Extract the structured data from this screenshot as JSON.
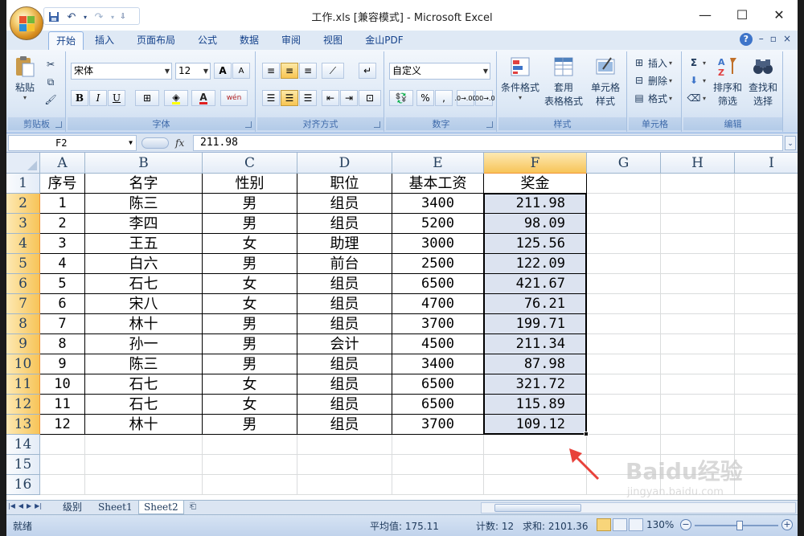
{
  "title_bar": {
    "title": "工作.xls  [兼容模式] - Microsoft Excel",
    "minimize": "—",
    "maximize": "☐",
    "close": "✕"
  },
  "tabs": [
    "开始",
    "插入",
    "页面布局",
    "公式",
    "数据",
    "审阅",
    "视图",
    "金山PDF"
  ],
  "ribbon": {
    "clipboard": {
      "label": "剪贴板",
      "paste": "粘贴"
    },
    "font": {
      "label": "字体",
      "name": "宋体",
      "size": "12",
      "bold": "B",
      "italic": "I",
      "underline": "U",
      "grow": "A",
      "shrink": "A",
      "font_color": "A",
      "phonetic": "wén"
    },
    "alignment": {
      "label": "对齐方式"
    },
    "number": {
      "label": "数字",
      "format": "自定义",
      "percent": "%"
    },
    "styles": {
      "label": "样式",
      "conditional": "条件格式",
      "table_line1": "套用",
      "table_line2": "表格格式",
      "cell_line1": "单元格",
      "cell_line2": "样式"
    },
    "cells": {
      "label": "单元格",
      "insert": "插入",
      "delete": "删除",
      "format": "格式"
    },
    "editing": {
      "label": "编辑",
      "sort_line1": "排序和",
      "sort_line2": "筛选",
      "find_line1": "查找和",
      "find_line2": "选择"
    }
  },
  "formula_bar": {
    "name_box": "F2",
    "fx": "fx",
    "formula": "211.98"
  },
  "columns": [
    "A",
    "B",
    "C",
    "D",
    "E",
    "F",
    "G",
    "H",
    "I"
  ],
  "rows": [
    "1",
    "2",
    "3",
    "4",
    "5",
    "6",
    "7",
    "8",
    "9",
    "10",
    "11",
    "12",
    "13",
    "14",
    "15",
    "16"
  ],
  "table": {
    "headers": [
      "序号",
      "名字",
      "性别",
      "职位",
      "基本工资",
      "奖金"
    ],
    "data": [
      [
        "1",
        "陈三",
        "男",
        "组员",
        "3400",
        "211.98"
      ],
      [
        "2",
        "李四",
        "男",
        "组员",
        "5200",
        "98.09"
      ],
      [
        "3",
        "王五",
        "女",
        "助理",
        "3000",
        "125.56"
      ],
      [
        "4",
        "白六",
        "男",
        "前台",
        "2500",
        "122.09"
      ],
      [
        "5",
        "石七",
        "女",
        "组员",
        "6500",
        "421.67"
      ],
      [
        "6",
        "宋八",
        "女",
        "组员",
        "4700",
        "76.21"
      ],
      [
        "7",
        "林十",
        "男",
        "组员",
        "3700",
        "199.71"
      ],
      [
        "8",
        "孙一",
        "男",
        "会计",
        "4500",
        "211.34"
      ],
      [
        "9",
        "陈三",
        "男",
        "组员",
        "3400",
        "87.98"
      ],
      [
        "10",
        "石七",
        "女",
        "组员",
        "6500",
        "321.72"
      ],
      [
        "11",
        "石七",
        "女",
        "组员",
        "6500",
        "115.89"
      ],
      [
        "12",
        "林十",
        "男",
        "组员",
        "3700",
        "109.12"
      ]
    ]
  },
  "sheets": [
    "级别",
    "Sheet1",
    "Sheet2"
  ],
  "active_sheet": "Sheet2",
  "status": {
    "ready": "就绪",
    "average": "平均值: 175.11",
    "count": "计数: 12",
    "sum": "求和: 2101.36",
    "zoom": "130%"
  },
  "watermark": {
    "brand": "Baidu经验",
    "url": "jingyan.baidu.com"
  },
  "colors": {
    "accent": "#f7c458",
    "selection": "#dce3f0",
    "ribbon": "#dbe7f5",
    "arrow": "#e8413a"
  }
}
